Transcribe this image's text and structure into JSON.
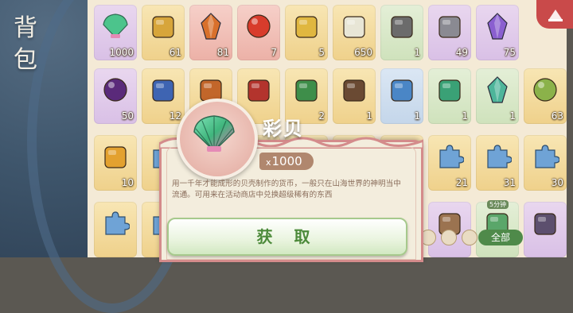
{
  "sidebar": {
    "title_line1": "背",
    "title_line2": "包"
  },
  "inventory": {
    "rows": [
      [
        {
          "icon": "rainbow-shell-icon",
          "rarity": "purple",
          "count": "1000"
        },
        {
          "icon": "golden-trinket-icon",
          "rarity": "gold",
          "count": "61"
        },
        {
          "icon": "amber-crystal-icon",
          "rarity": "red",
          "count": "81"
        },
        {
          "icon": "red-orb-icon",
          "rarity": "red",
          "count": "7"
        },
        {
          "icon": "gold-ingot-icon",
          "rarity": "gold",
          "count": "5"
        },
        {
          "icon": "rice-bowl-icon",
          "rarity": "gold",
          "count": "650"
        },
        {
          "icon": "ore-bag-icon",
          "rarity": "green",
          "count": "1"
        },
        {
          "icon": "stone-pile-icon",
          "rarity": "purple",
          "count": "49"
        },
        {
          "icon": "purple-crystal-icon",
          "rarity": "purple",
          "count": "75"
        }
      ],
      [
        {
          "icon": "dark-orb-icon",
          "rarity": "purple",
          "count": "50"
        },
        {
          "icon": "porcelain-vase-icon",
          "rarity": "gold",
          "count": "12"
        },
        {
          "icon": "scroll-ticket-icon",
          "rarity": "gold",
          "count": ""
        },
        {
          "icon": "red-letter-icon",
          "rarity": "gold",
          "count": ""
        },
        {
          "icon": "green-book-icon",
          "rarity": "gold",
          "count": "2"
        },
        {
          "icon": "brown-book-icon",
          "rarity": "gold",
          "count": "1"
        },
        {
          "icon": "blue-token-icon",
          "rarity": "blue",
          "count": "1"
        },
        {
          "icon": "jade-token-icon",
          "rarity": "green",
          "count": "1"
        },
        {
          "icon": "teal-crystal-icon",
          "rarity": "green",
          "count": "1"
        },
        {
          "icon": "fruit-icon",
          "rarity": "gold",
          "count": "63"
        }
      ],
      [
        {
          "icon": "amber-lantern-icon",
          "rarity": "gold",
          "count": "10"
        },
        {
          "icon": "puzzle-piece-icon",
          "rarity": "gold",
          "count": ""
        },
        {
          "icon": "puzzle-piece-icon",
          "rarity": "gold",
          "count": ""
        },
        {
          "icon": "puzzle-piece-icon",
          "rarity": "gold",
          "count": ""
        },
        {
          "icon": "puzzle-piece-icon",
          "rarity": "gold",
          "count": ""
        },
        {
          "icon": "puzzle-piece-icon",
          "rarity": "gold",
          "count": ""
        },
        {
          "icon": "puzzle-piece-icon",
          "rarity": "gold",
          "count": ""
        },
        {
          "icon": "puzzle-piece-icon",
          "rarity": "gold",
          "count": "21"
        },
        {
          "icon": "puzzle-piece-icon",
          "rarity": "gold",
          "count": "31"
        },
        {
          "icon": "puzzle-piece-icon",
          "rarity": "gold",
          "count": "30"
        }
      ],
      [
        {
          "icon": "puzzle-piece-icon",
          "rarity": "gold",
          "count": ""
        },
        {
          "icon": "puzzle-piece-icon",
          "rarity": "gold",
          "count": ""
        },
        {
          "icon": "puzzle-piece-icon",
          "rarity": "gold",
          "count": ""
        },
        {
          "icon": "puzzle-piece-icon",
          "rarity": "gold",
          "count": ""
        },
        {
          "icon": "puzzle-piece-icon",
          "rarity": "gold",
          "count": ""
        },
        {
          "icon": "puzzle-piece-icon",
          "rarity": "gold",
          "count": ""
        },
        {
          "icon": "puzzle-piece-icon",
          "rarity": "gold",
          "count": ""
        },
        {
          "icon": "wood-block-icon",
          "rarity": "purple",
          "count": ""
        },
        {
          "icon": "timer-chest-icon",
          "rarity": "green",
          "count": "",
          "badge": "5分钟"
        },
        {
          "icon": "dark-spirit-icon",
          "rarity": "purple",
          "count": ""
        }
      ]
    ]
  },
  "detail": {
    "name": "彩贝",
    "qty_prefix": "x",
    "qty": "1000",
    "description": "用一千年才能成形的贝壳制作的货币，一般只在山海世界的神明当中流通。可用来在活动商店中兑换超级稀有的东西",
    "action_label": "获 取"
  },
  "toolbar": {
    "filter_label": "全部"
  },
  "colors": {
    "close_button": "#c94a4a",
    "card_border": "#d48b8b",
    "action_text": "#4c8a3a",
    "filter_button": "#4f8a4a"
  }
}
